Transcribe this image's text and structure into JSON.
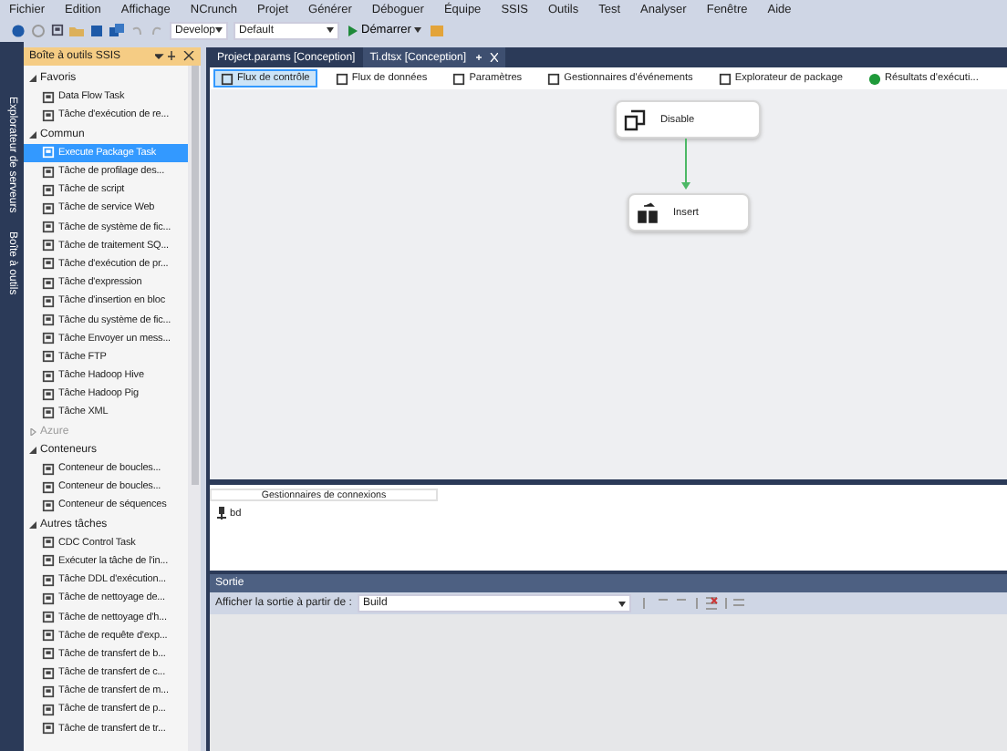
{
  "menu": [
    "Fichier",
    "Edition",
    "Affichage",
    "NCrunch",
    "Projet",
    "Générer",
    "Déboguer",
    "Équipe",
    "SSIS",
    "Outils",
    "Test",
    "Analyser",
    "Fenêtre",
    "Aide"
  ],
  "toolbar": {
    "configuration": "Develop",
    "platform": "Default",
    "start": "Démarrer"
  },
  "side_strip": [
    "Explorateur de serveurs",
    "Boîte à outils"
  ],
  "toolbox": {
    "title": "Boîte à outils SSIS",
    "groups": [
      {
        "name": "Favoris",
        "expanded": true,
        "disabled": false,
        "items": [
          {
            "label": "Data Flow Task",
            "selected": false
          },
          {
            "label": "Tâche d'exécution de re...",
            "selected": false
          }
        ]
      },
      {
        "name": "Commun",
        "expanded": true,
        "disabled": false,
        "items": [
          {
            "label": "Execute Package Task",
            "selected": true
          },
          {
            "label": "Tâche de profilage des...",
            "selected": false
          },
          {
            "label": "Tâche de script",
            "selected": false
          },
          {
            "label": "Tâche de service Web",
            "selected": false
          },
          {
            "label": "Tâche de système de fic...",
            "selected": false
          },
          {
            "label": "Tâche de traitement SQ...",
            "selected": false
          },
          {
            "label": "Tâche d'exécution de pr...",
            "selected": false
          },
          {
            "label": "Tâche d'expression",
            "selected": false
          },
          {
            "label": "Tâche d'insertion en bloc",
            "selected": false
          },
          {
            "label": "Tâche du système de fic...",
            "selected": false
          },
          {
            "label": "Tâche Envoyer un mess...",
            "selected": false
          },
          {
            "label": "Tâche FTP",
            "selected": false
          },
          {
            "label": "Tâche Hadoop Hive",
            "selected": false
          },
          {
            "label": "Tâche Hadoop Pig",
            "selected": false
          },
          {
            "label": "Tâche XML",
            "selected": false
          }
        ]
      },
      {
        "name": "Azure",
        "expanded": false,
        "disabled": true
      },
      {
        "name": "Conteneurs",
        "expanded": true,
        "disabled": false,
        "items": [
          {
            "label": "Conteneur de boucles...",
            "selected": false
          },
          {
            "label": "Conteneur de boucles...",
            "selected": false
          },
          {
            "label": "Conteneur de séquences",
            "selected": false
          }
        ]
      },
      {
        "name": "Autres tâches",
        "expanded": true,
        "disabled": false,
        "items": [
          {
            "label": "CDC Control Task",
            "selected": false
          },
          {
            "label": "Exécuter la tâche de l'in...",
            "selected": false
          },
          {
            "label": "Tâche DDL d'exécution...",
            "selected": false
          },
          {
            "label": "Tâche de nettoyage de...",
            "selected": false
          },
          {
            "label": "Tâche de nettoyage d'h...",
            "selected": false
          },
          {
            "label": "Tâche de requête d'exp...",
            "selected": false
          },
          {
            "label": "Tâche de transfert de b...",
            "selected": false
          },
          {
            "label": "Tâche de transfert de c...",
            "selected": false
          },
          {
            "label": "Tâche de transfert de m...",
            "selected": false
          },
          {
            "label": "Tâche de transfert de p...",
            "selected": false
          },
          {
            "label": "Tâche de transfert de tr...",
            "selected": false
          }
        ]
      }
    ]
  },
  "doc_tabs": [
    {
      "label": "Project.params [Conception]",
      "selected": false
    },
    {
      "label": "Ti.dtsx [Conception]",
      "selected": true
    }
  ],
  "designer_tabs": [
    {
      "label": "Flux de contrôle",
      "selected": true
    },
    {
      "label": "Flux de données",
      "selected": false
    },
    {
      "label": "Paramètres",
      "selected": false
    },
    {
      "label": "Gestionnaires d'événements",
      "selected": false
    },
    {
      "label": "Explorateur de package",
      "selected": false
    },
    {
      "label": "Résultats d'exécuti...",
      "selected": false
    }
  ],
  "canvas": {
    "tasks": [
      {
        "label": "Disable",
        "kind": "script"
      },
      {
        "label": "Insert",
        "kind": "transfer"
      }
    ]
  },
  "connection_managers": {
    "title": "Gestionnaires de connexions",
    "items": [
      "bd"
    ]
  },
  "output": {
    "title": "Sortie",
    "label": "Afficher la sortie à partir de :",
    "source": "Build"
  }
}
